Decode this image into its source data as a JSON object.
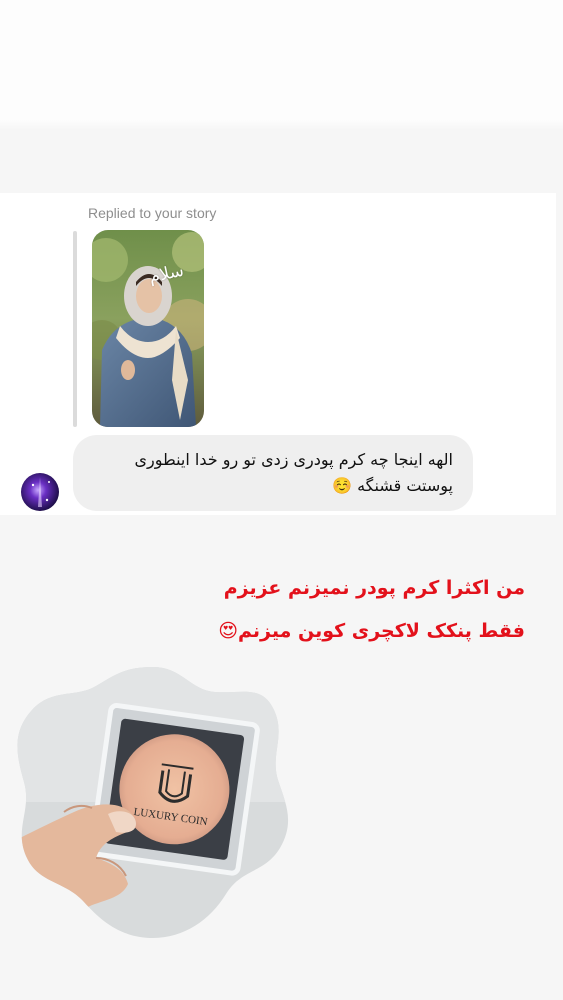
{
  "story_reply": {
    "label": "Replied to your story",
    "sticker_text": "سلام"
  },
  "message": {
    "text": "الهه اینجا چه کرم پودری زدی تو رو خدا اینطوری پوستت قشنگه ☺️"
  },
  "caption": {
    "line1": "من اکثرا کرم پودر نمیزنم عزیزم",
    "line2": "فقط پنکک لاکچری کوین میزنم😍"
  },
  "product": {
    "brand": "LUXURY COIN"
  },
  "colors": {
    "caption": "#e3111b",
    "bubble": "#efefef",
    "label": "#8e8e8e"
  }
}
